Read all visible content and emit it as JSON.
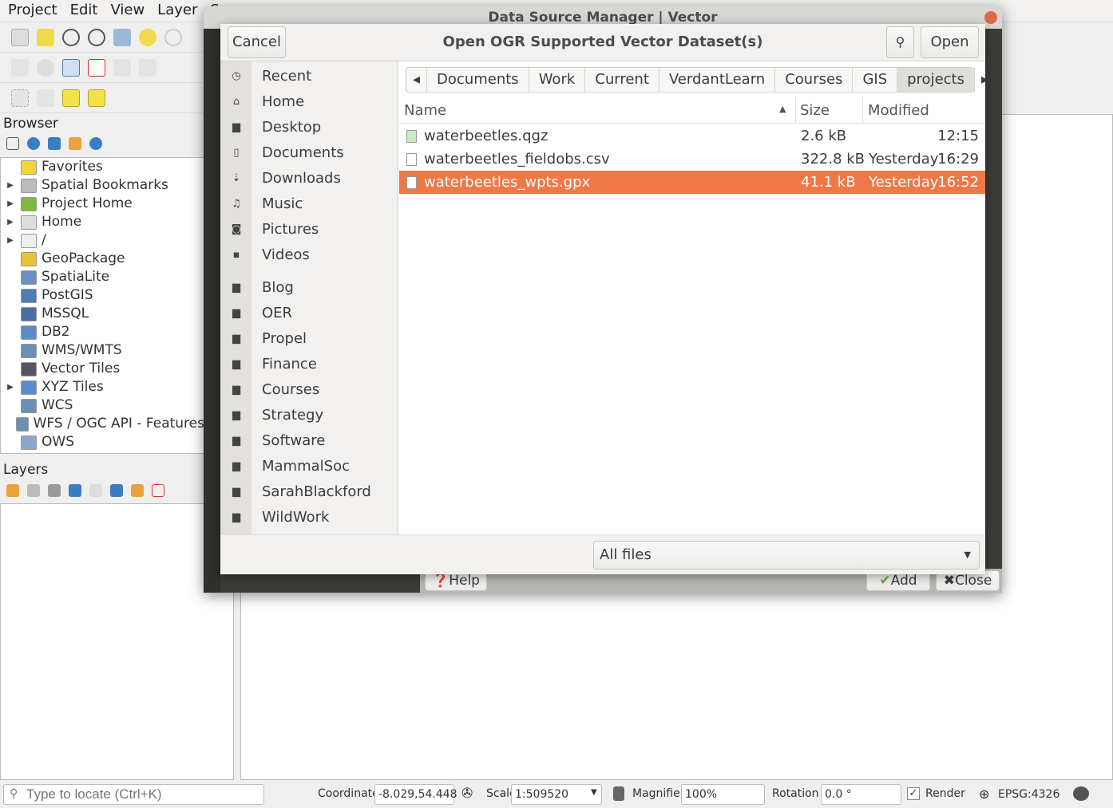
{
  "menu": [
    "Project",
    "Edit",
    "View",
    "Layer",
    "S"
  ],
  "browser": {
    "title": "Browser",
    "items": [
      {
        "label": "Favorites",
        "expand": false,
        "icon": "star-icon",
        "color": "#f5d33a"
      },
      {
        "label": "Spatial Bookmarks",
        "expand": true,
        "icon": "bookmark-icon",
        "color": "#bbb"
      },
      {
        "label": "Project Home",
        "expand": true,
        "icon": "project-home-icon",
        "color": "#7cba3d"
      },
      {
        "label": "Home",
        "expand": true,
        "icon": "home-icon",
        "color": "#ddd"
      },
      {
        "label": "/",
        "expand": true,
        "icon": "folder-icon",
        "color": "#eee"
      },
      {
        "label": "GeoPackage",
        "expand": false,
        "icon": "geopackage-icon",
        "color": "#e8c13a"
      },
      {
        "label": "SpatiaLite",
        "expand": false,
        "icon": "spatialite-icon",
        "color": "#6a8fc0"
      },
      {
        "label": "PostGIS",
        "expand": false,
        "icon": "postgis-icon",
        "color": "#4f7db5"
      },
      {
        "label": "MSSQL",
        "expand": false,
        "icon": "mssql-icon",
        "color": "#4a6fa0"
      },
      {
        "label": "DB2",
        "expand": false,
        "icon": "db2-icon",
        "color": "#5b8cc9"
      },
      {
        "label": "WMS/WMTS",
        "expand": false,
        "icon": "wms-icon",
        "color": "#6b8fb5"
      },
      {
        "label": "Vector Tiles",
        "expand": false,
        "icon": "vector-tiles-icon",
        "color": "#556"
      },
      {
        "label": "XYZ Tiles",
        "expand": true,
        "icon": "xyz-tiles-icon",
        "color": "#5b8cc9"
      },
      {
        "label": "WCS",
        "expand": false,
        "icon": "wcs-icon",
        "color": "#6b8fb5"
      },
      {
        "label": "WFS / OGC API - Features",
        "expand": false,
        "icon": "wfs-icon",
        "color": "#6b8fb5"
      },
      {
        "label": "OWS",
        "expand": false,
        "icon": "ows-icon",
        "color": "#8aa8cc"
      }
    ]
  },
  "layers": {
    "title": "Layers"
  },
  "status": {
    "locate_placeholder": "Type to locate (Ctrl+K)",
    "coordinate_label": "Coordinate",
    "coordinate": "-8.029,54.448",
    "scale_label": "Scale",
    "scale": "1:509520",
    "magnifier_label": "Magnifier",
    "magnifier": "100%",
    "rotation_label": "Rotation",
    "rotation": "0.0 °",
    "render_label": "Render",
    "render_checked": true,
    "crs": "EPSG:4326"
  },
  "dsm": {
    "title": "Data Source Manager | Vector",
    "help": "Help",
    "add": "Add",
    "close": "Close"
  },
  "dialog": {
    "title": "Open OGR Supported Vector Dataset(s)",
    "cancel": "Cancel",
    "open": "Open",
    "places": [
      {
        "label": "Recent",
        "icon": "clock-icon",
        "glyph": "◷"
      },
      {
        "label": "Home",
        "icon": "home-icon",
        "glyph": "⌂"
      },
      {
        "label": "Desktop",
        "icon": "folder-icon",
        "glyph": "▆"
      },
      {
        "label": "Documents",
        "icon": "document-icon",
        "glyph": "▯"
      },
      {
        "label": "Downloads",
        "icon": "download-icon",
        "glyph": "⇣"
      },
      {
        "label": "Music",
        "icon": "music-icon",
        "glyph": "♫"
      },
      {
        "label": "Pictures",
        "icon": "camera-icon",
        "glyph": "◙"
      },
      {
        "label": "Videos",
        "icon": "video-icon",
        "glyph": "▪"
      }
    ],
    "bookmarks": [
      "Blog",
      "OER",
      "Propel",
      "Finance",
      "Courses",
      "Strategy",
      "Software",
      "MammalSoc",
      "SarahBlackford",
      "WildWork"
    ],
    "path": [
      "Documents",
      "Work",
      "Current",
      "VerdantLearn",
      "Courses",
      "GIS",
      "projects"
    ],
    "columns": {
      "name": "Name",
      "size": "Size",
      "modified": "Modified"
    },
    "files": [
      {
        "name": "waterbeetles.qgz",
        "size": "2.6 kB",
        "day": "",
        "time": "12:15",
        "selected": false
      },
      {
        "name": "waterbeetles_fieldobs.csv",
        "size": "322.8 kB",
        "day": "Yesterday",
        "time": "16:29",
        "selected": false
      },
      {
        "name": "waterbeetles_wpts.gpx",
        "size": "41.1 kB",
        "day": "Yesterday",
        "time": "16:52",
        "selected": true
      }
    ],
    "filter": "All files"
  },
  "colors": {
    "selection": "#f07746"
  }
}
